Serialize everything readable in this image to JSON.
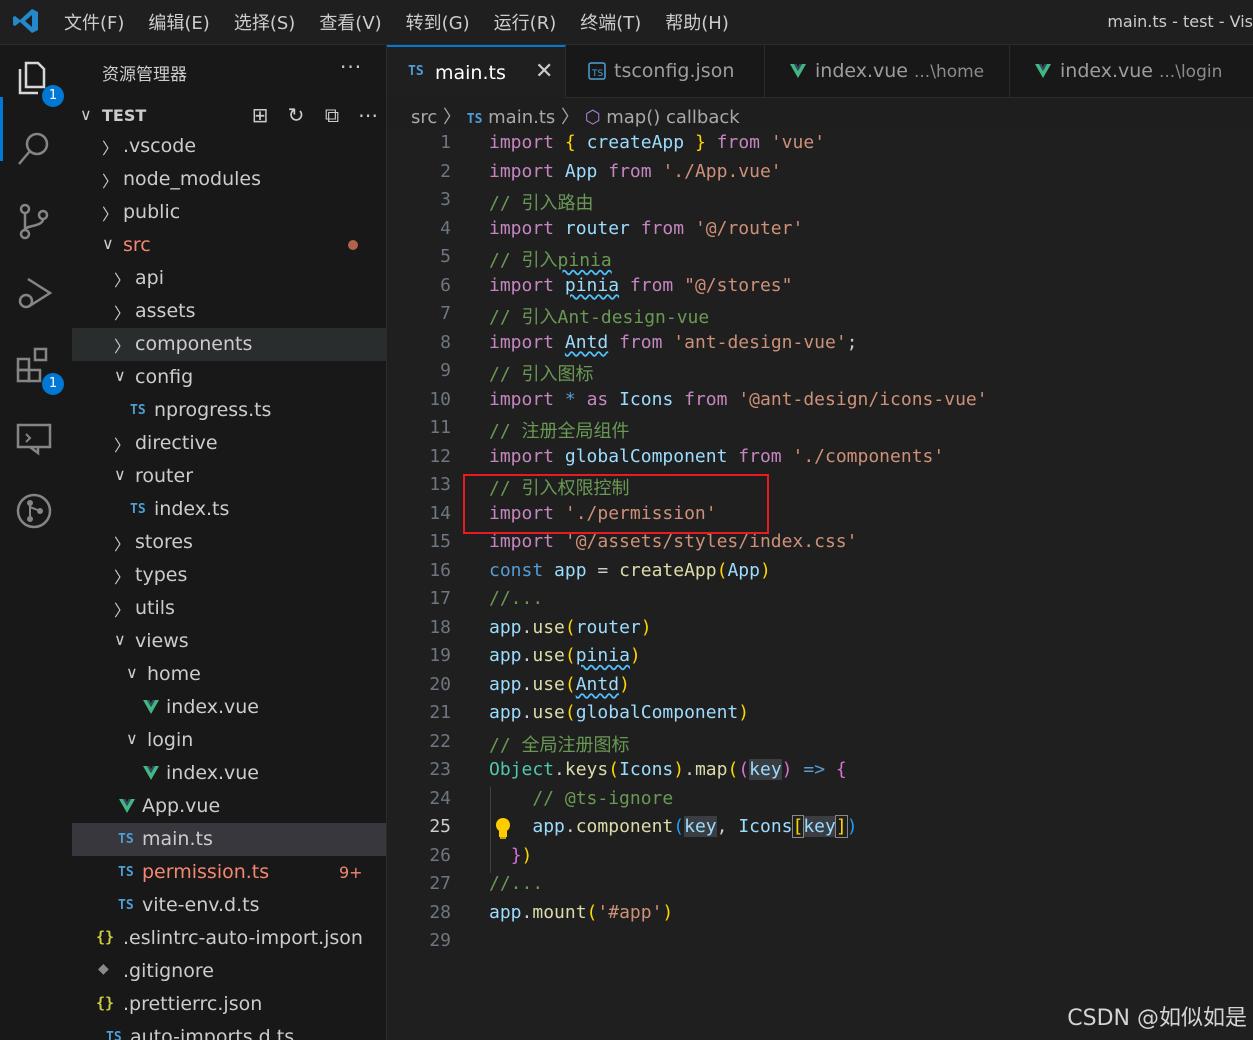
{
  "titlebar": {
    "menu": [
      "文件(F)",
      "编辑(E)",
      "选择(S)",
      "查看(V)",
      "转到(G)",
      "运行(R)",
      "终端(T)",
      "帮助(H)"
    ],
    "window_title": "main.ts - test - Vis"
  },
  "activity_bar": {
    "items": [
      {
        "name": "explorer-icon",
        "badge": "1"
      },
      {
        "name": "search-icon"
      },
      {
        "name": "source-control-icon"
      },
      {
        "name": "run-debug-icon"
      },
      {
        "name": "extensions-icon",
        "badge": "1"
      },
      {
        "name": "remote-icon"
      },
      {
        "name": "git-graph-icon"
      }
    ]
  },
  "sidebar": {
    "title": "资源管理器",
    "more": "···",
    "section": "TEST",
    "tree": [
      {
        "label": ".vscode",
        "type": "folder",
        "open": false,
        "depth": 0
      },
      {
        "label": "node_modules",
        "type": "folder",
        "open": false,
        "depth": 0
      },
      {
        "label": "public",
        "type": "folder",
        "open": false,
        "depth": 0
      },
      {
        "label": "src",
        "type": "folder",
        "open": true,
        "depth": 0,
        "error": true
      },
      {
        "label": "api",
        "type": "folder",
        "open": false,
        "depth": 1
      },
      {
        "label": "assets",
        "type": "folder",
        "open": false,
        "depth": 1
      },
      {
        "label": "components",
        "type": "folder",
        "open": false,
        "depth": 1,
        "hover": true
      },
      {
        "label": "config",
        "type": "folder",
        "open": true,
        "depth": 1
      },
      {
        "label": "nprogress.ts",
        "type": "ts",
        "depth": 2
      },
      {
        "label": "directive",
        "type": "folder",
        "open": false,
        "depth": 1
      },
      {
        "label": "router",
        "type": "folder",
        "open": true,
        "depth": 1
      },
      {
        "label": "index.ts",
        "type": "ts",
        "depth": 2
      },
      {
        "label": "stores",
        "type": "folder",
        "open": false,
        "depth": 1
      },
      {
        "label": "types",
        "type": "folder",
        "open": false,
        "depth": 1
      },
      {
        "label": "utils",
        "type": "folder",
        "open": false,
        "depth": 1
      },
      {
        "label": "views",
        "type": "folder",
        "open": true,
        "depth": 1
      },
      {
        "label": "home",
        "type": "folder",
        "open": true,
        "depth": 2
      },
      {
        "label": "index.vue",
        "type": "vue",
        "depth": 3
      },
      {
        "label": "login",
        "type": "folder",
        "open": true,
        "depth": 2
      },
      {
        "label": "index.vue",
        "type": "vue",
        "depth": 3
      },
      {
        "label": "App.vue",
        "type": "vue",
        "depth": 1
      },
      {
        "label": "main.ts",
        "type": "ts",
        "depth": 1,
        "selected": true
      },
      {
        "label": "permission.ts",
        "type": "ts",
        "depth": 1,
        "error": true,
        "count": "9+"
      },
      {
        "label": "vite-env.d.ts",
        "type": "ts",
        "depth": 1
      },
      {
        "label": ".eslintrc-auto-import.json",
        "type": "json",
        "depth": 0
      },
      {
        "label": ".gitignore",
        "type": "git",
        "depth": 0
      },
      {
        "label": ".prettierrc.json",
        "type": "json",
        "depth": 0
      },
      {
        "label": "auto-imports.d.ts",
        "type": "ts",
        "depth": 0
      }
    ]
  },
  "tabs": [
    {
      "icon": "TS",
      "label": "main.ts",
      "active": true,
      "close": "✕"
    },
    {
      "icon": "tsconfig",
      "label": "tsconfig.json",
      "active": false
    },
    {
      "icon": "vue",
      "label": "index.vue",
      "desc": "...\\home",
      "active": false
    },
    {
      "icon": "vue",
      "label": "index.vue",
      "desc": "...\\login",
      "active": false
    }
  ],
  "breadcrumb": {
    "a": "src",
    "b": "main.ts",
    "c": "map() callback"
  },
  "editor": {
    "current_line": 25,
    "line_count": 29
  },
  "watermark": "CSDN @如似如是"
}
